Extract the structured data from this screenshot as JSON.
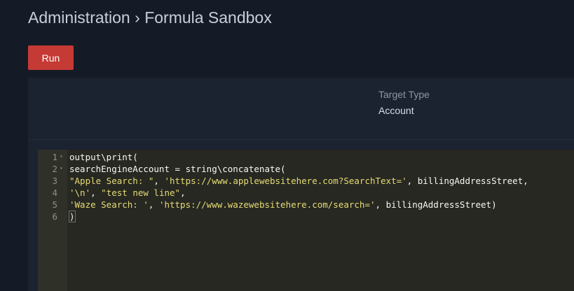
{
  "header": {
    "breadcrumb_root": "Administration",
    "separator": "›",
    "page": "Formula Sandbox"
  },
  "toolbar": {
    "run_label": "Run"
  },
  "target_type": {
    "label": "Target Type",
    "value": "Account"
  },
  "editor": {
    "lines": [
      {
        "number": "1",
        "fold": true,
        "tokens": [
          {
            "t": "output\\print(",
            "k": "plain"
          }
        ]
      },
      {
        "number": "2",
        "fold": true,
        "tokens": [
          {
            "t": "searchEngineAccount = string\\concatenate(",
            "k": "plain"
          }
        ]
      },
      {
        "number": "3",
        "fold": false,
        "tokens": [
          {
            "t": "\"Apple Search: \"",
            "k": "string"
          },
          {
            "t": ", ",
            "k": "plain"
          },
          {
            "t": "'https://www.applewebsitehere.com?SearchText='",
            "k": "string"
          },
          {
            "t": ", billingAddressStreet,",
            "k": "plain"
          }
        ]
      },
      {
        "number": "4",
        "fold": false,
        "tokens": [
          {
            "t": "'\\n'",
            "k": "string"
          },
          {
            "t": ", ",
            "k": "plain"
          },
          {
            "t": "\"test new line\"",
            "k": "string"
          },
          {
            "t": ",",
            "k": "plain"
          }
        ]
      },
      {
        "number": "5",
        "fold": false,
        "tokens": [
          {
            "t": "'Waze Search: '",
            "k": "string"
          },
          {
            "t": ", ",
            "k": "plain"
          },
          {
            "t": "'https://www.wazewebsitehere.com/search='",
            "k": "string"
          },
          {
            "t": ", billingAddressStreet)",
            "k": "plain"
          }
        ]
      },
      {
        "number": "6",
        "fold": false,
        "tokens": [
          {
            "t": ")",
            "k": "cursor"
          }
        ]
      }
    ]
  },
  "icons": {
    "fold": "fold-arrow-icon"
  },
  "colors": {
    "background": "#141b26",
    "panel": "#1b2330",
    "editor_bg": "#272822",
    "gutter_bg": "#2f3129",
    "run_button": "#c63a35",
    "string": "#e6db74",
    "code_text": "#f8f8f2"
  }
}
